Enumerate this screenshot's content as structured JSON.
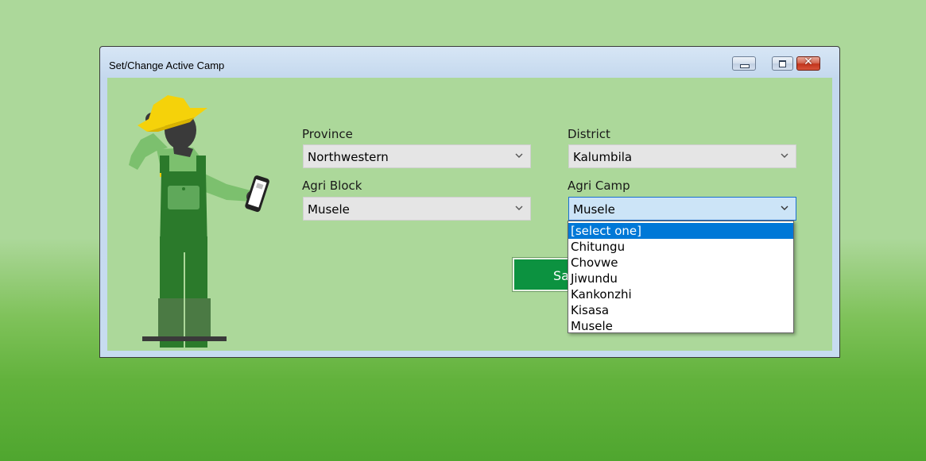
{
  "window": {
    "title": "Set/Change Active Camp",
    "controls": {
      "minimize": "minimize-icon",
      "maximize": "maximize-icon",
      "close": "close-icon",
      "close_glyph": "✕"
    }
  },
  "form": {
    "province": {
      "label": "Province",
      "value": "Northwestern"
    },
    "district": {
      "label": "District",
      "value": "Kalumbila"
    },
    "agri_block": {
      "label": "Agri Block",
      "value": "Musele"
    },
    "agri_camp": {
      "label": "Agri Camp",
      "value": "Musele",
      "expanded": true
    },
    "save_label": "Sa"
  },
  "agri_camp_options": [
    {
      "label": "[select one]",
      "highlighted": true
    },
    {
      "label": "Chitungu"
    },
    {
      "label": "Chovwe"
    },
    {
      "label": "Jiwundu"
    },
    {
      "label": "Kankonzhi"
    },
    {
      "label": "Kisasa"
    },
    {
      "label": "Musele"
    }
  ],
  "colors": {
    "background": "#acd89a",
    "save_button": "#0c9240",
    "highlight": "#0078d7",
    "farmer_hat": "#f5d20a",
    "farmer_overalls": "#2b7a2b",
    "farmer_shirt": "#7cc06e"
  },
  "illustration": "farmer-with-phone"
}
